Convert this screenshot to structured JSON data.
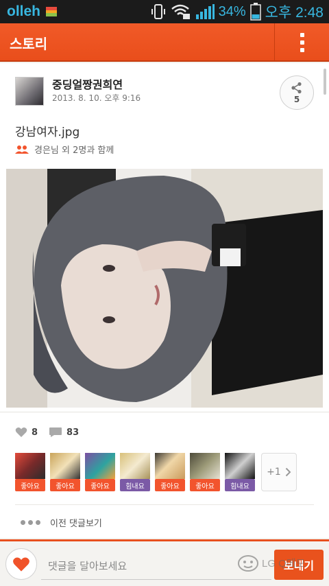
{
  "status_bar": {
    "carrier": "olleh",
    "battery_percent": "34%",
    "time": "오후 2:48",
    "icons": [
      "vibrate-icon",
      "wifi-lock-icon",
      "signal-icon",
      "battery-icon"
    ]
  },
  "header": {
    "title": "스토리",
    "menu_icon": "overflow-menu-icon"
  },
  "post": {
    "author": "중딩얼짱권희연",
    "date": "2013. 8. 10. 오후 9:16",
    "share_count": "5",
    "title": "강남여자.jpg",
    "with_text": "경은님 외 2명과 함께"
  },
  "stats": {
    "likes": "8",
    "comments": "83"
  },
  "reactions": [
    {
      "label": "좋아요",
      "color": "#f2542d"
    },
    {
      "label": "좋아요",
      "color": "#f2542d"
    },
    {
      "label": "좋아요",
      "color": "#f2542d"
    },
    {
      "label": "힘내요",
      "color": "#7b5aa6"
    },
    {
      "label": "좋아요",
      "color": "#f2542d"
    },
    {
      "label": "좋아요",
      "color": "#f2542d"
    },
    {
      "label": "힘내요",
      "color": "#7b5aa6"
    }
  ],
  "more_reactions": "+1",
  "prev_comments": "이전 댓글보기",
  "comment_box": {
    "placeholder": "댓글을 달아보세요",
    "send_label": "보내기",
    "watermark": "LG Q메모"
  },
  "colors": {
    "accent": "#e94e1b",
    "status_blue": "#38b7e0",
    "cheer_purple": "#7b5aa6"
  }
}
